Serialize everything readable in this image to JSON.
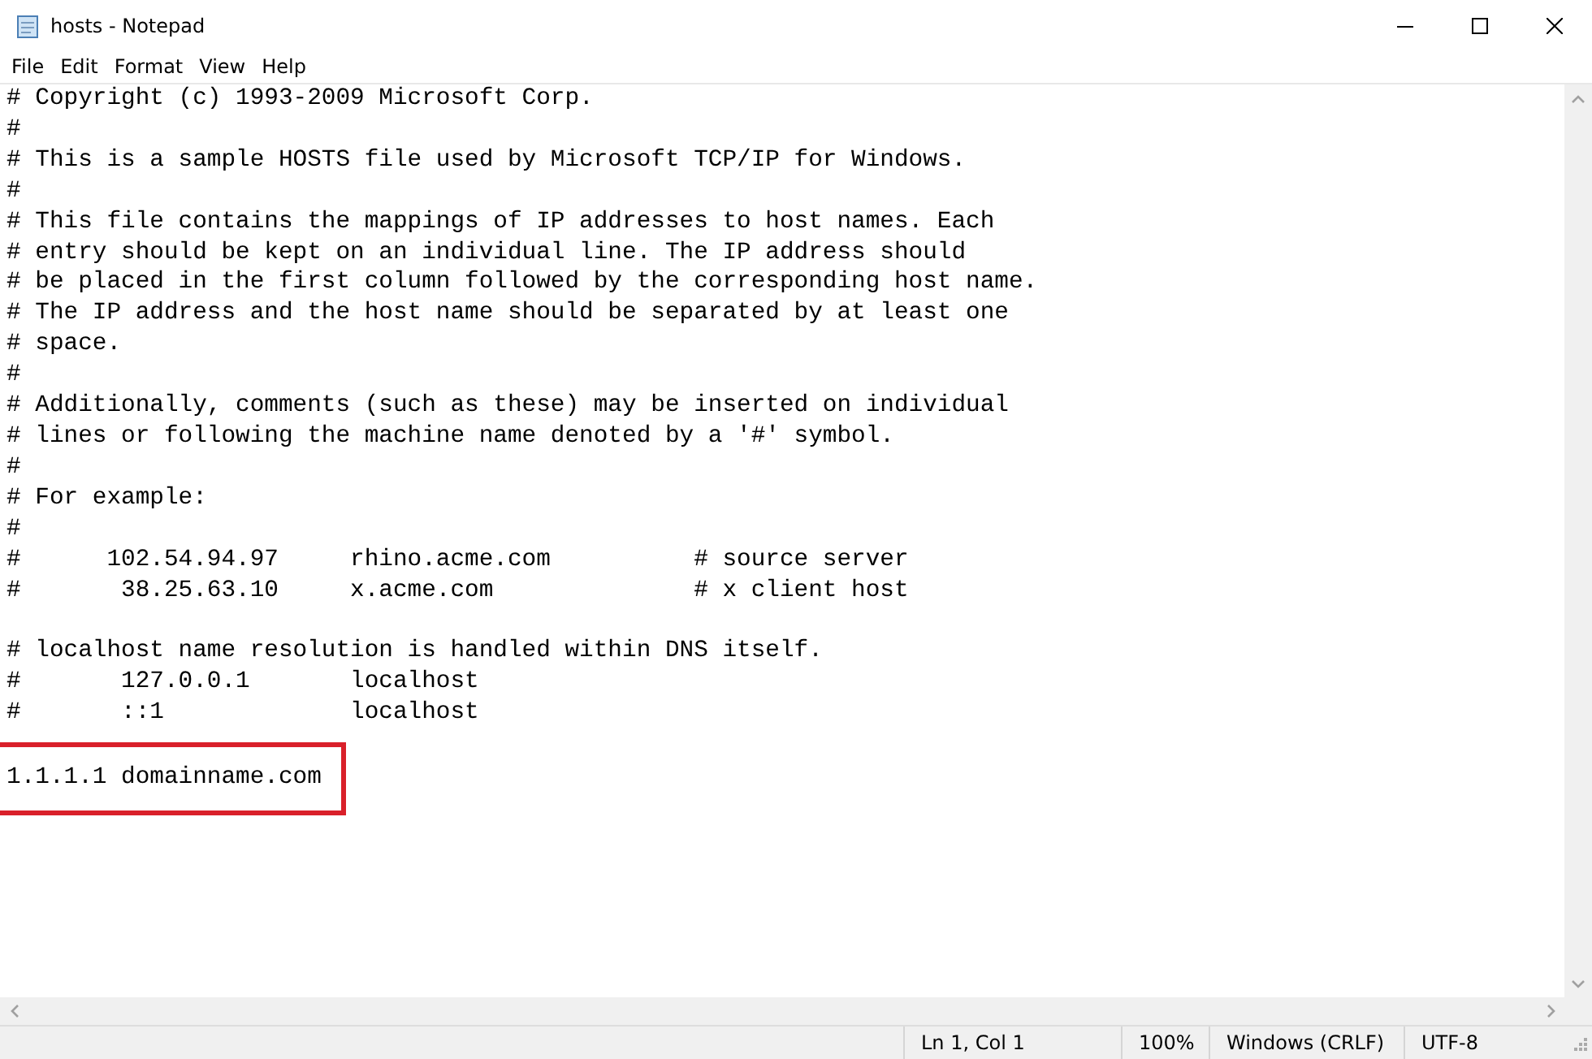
{
  "window": {
    "title": "hosts - Notepad"
  },
  "menu": [
    "File",
    "Edit",
    "Format",
    "View",
    "Help"
  ],
  "editor": {
    "blocks": [
      {
        "highlighted": false,
        "lines": [
          "# Copyright (c) 1993-2009 Microsoft Corp.",
          "#",
          "# This is a sample HOSTS file used by Microsoft TCP/IP for Windows.",
          "#",
          "# This file contains the mappings of IP addresses to host names. Each",
          "# entry should be kept on an individual line. The IP address should",
          "# be placed in the first column followed by the corresponding host name.",
          "# The IP address and the host name should be separated by at least one",
          "# space.",
          "#",
          "# Additionally, comments (such as these) may be inserted on individual",
          "# lines or following the machine name denoted by a '#' symbol.",
          "#",
          "# For example:",
          "#",
          "#      102.54.94.97     rhino.acme.com          # source server",
          "#       38.25.63.10     x.acme.com              # x client host"
        ]
      },
      {
        "highlighted": false,
        "lines": [
          "# localhost name resolution is handled within DNS itself.",
          "#\t127.0.0.1       localhost",
          "#\t::1             localhost"
        ]
      },
      {
        "highlighted": true,
        "lines": [
          "1.1.1.1 domainname.com"
        ]
      }
    ]
  },
  "status_bar": [
    "Ln 1, Col 1",
    "100%",
    "Windows (CRLF)",
    "UTF-8"
  ]
}
